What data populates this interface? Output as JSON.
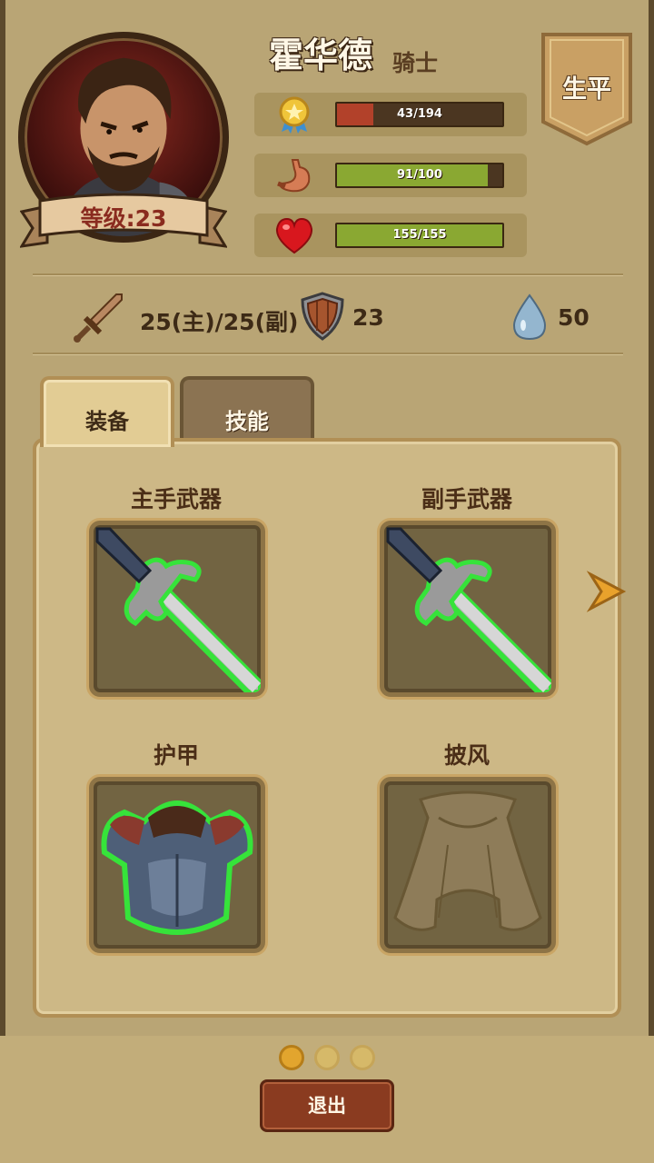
{
  "hero": {
    "name": "霍华德",
    "class": "骑士",
    "level_label": "等级:23"
  },
  "banner": {
    "label": "生平"
  },
  "stats": [
    {
      "icon": "medal-icon",
      "value": 43,
      "max": 194,
      "text": "43/194",
      "color": "#b2412a"
    },
    {
      "icon": "stomach-icon",
      "value": 91,
      "max": 100,
      "text": "91/100",
      "color": "#8aa832"
    },
    {
      "icon": "heart-icon",
      "value": 155,
      "max": 155,
      "text": "155/155",
      "color": "#8aa832"
    }
  ],
  "combat": {
    "attack": "25(主)/25(副)",
    "defense": "23",
    "mana": "50"
  },
  "tabs": [
    {
      "label": "装备",
      "active": true
    },
    {
      "label": "技能",
      "active": false
    }
  ],
  "equipment": {
    "main_weapon_label": "主手武器",
    "off_weapon_label": "副手武器",
    "armor_label": "护甲",
    "cloak_label": "披风"
  },
  "pager": {
    "pages": 3,
    "current": 1
  },
  "exit_label": "退出"
}
